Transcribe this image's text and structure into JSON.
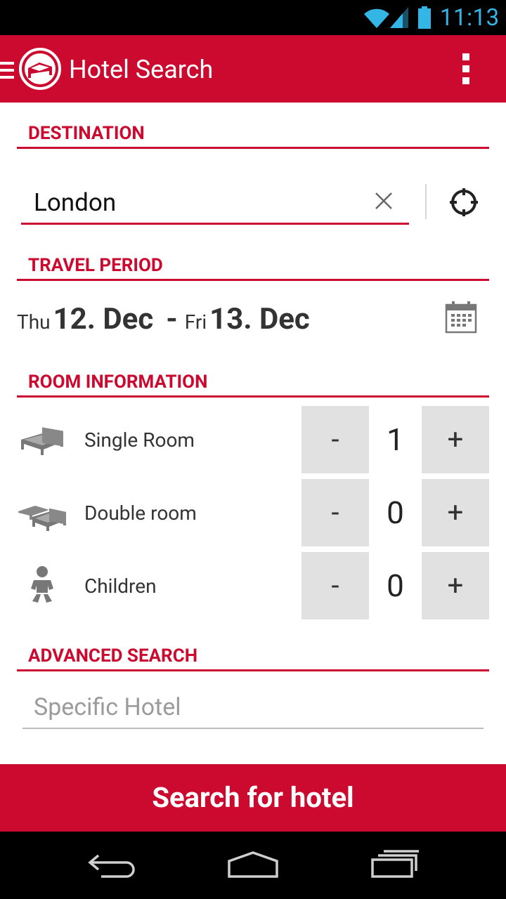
{
  "status_bar": {
    "time": "11:13"
  },
  "action_bar": {
    "title": "Hotel Search"
  },
  "sections": {
    "destination": "DESTINATION",
    "travel_period": "TRAVEL PERIOD",
    "room_information": "ROOM INFORMATION",
    "advanced_search": "ADVANCED SEARCH"
  },
  "destination": {
    "value": "London"
  },
  "travel": {
    "from_dow": "Thu",
    "from_date": "12. Dec",
    "separator": "-",
    "to_dow": "Fri",
    "to_date": "13. Dec"
  },
  "rooms": [
    {
      "label": "Single Room",
      "count": "1",
      "minus": "-",
      "plus": "+"
    },
    {
      "label": "Double room",
      "count": "0",
      "minus": "-",
      "plus": "+"
    },
    {
      "label": "Children",
      "count": "0",
      "minus": "-",
      "plus": "+"
    }
  ],
  "advanced": {
    "placeholder": "Specific Hotel"
  },
  "search_button": {
    "label": "Search for hotel"
  },
  "colors": {
    "brand": "#cc0a2f",
    "stepper_bg": "#e1e1e1",
    "status_time": "#33b5e5"
  }
}
